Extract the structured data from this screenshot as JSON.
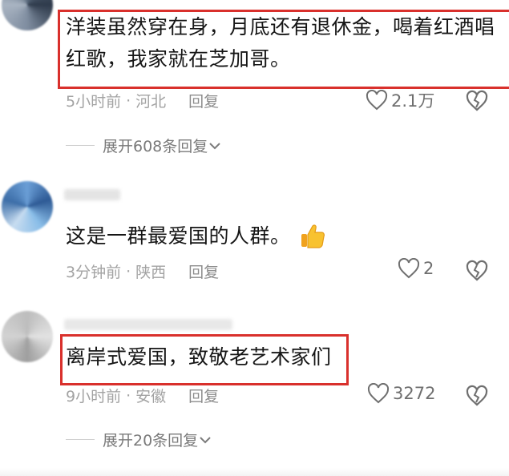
{
  "comments": [
    {
      "text": "洋装虽然穿在身，月底还有退休金，喝着红酒唱红歌，我家就在芝加哥。",
      "time": "5小时前",
      "location": "河北",
      "reply_label": "回复",
      "likes": "2.1万",
      "highlighted": true,
      "expand_label": "展开608条回复"
    },
    {
      "text": "这是一群最爱国的人群。",
      "emoji": "thumbs-up",
      "time": "3分钟前",
      "location": "陕西",
      "reply_label": "回复",
      "likes": "2",
      "highlighted": false
    },
    {
      "text": "离岸式爱国，致敬老艺术家们",
      "time": "9小时前",
      "location": "安徽",
      "reply_label": "回复",
      "likes": "3272",
      "highlighted": true,
      "expand_label": "展开20条回复"
    }
  ],
  "separator": "·",
  "colors": {
    "highlight_border": "#d9302c",
    "meta_text": "#a3a3a3",
    "body_text": "#161616"
  }
}
